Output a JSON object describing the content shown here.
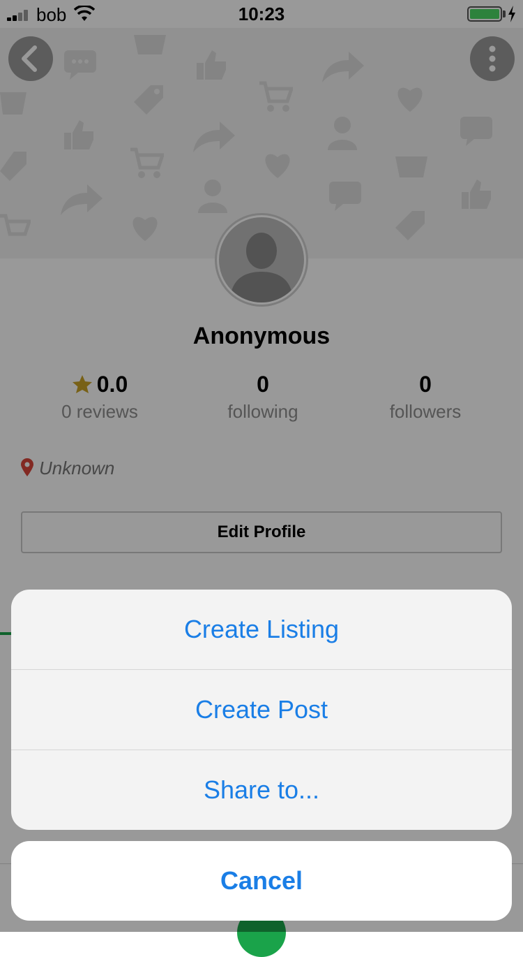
{
  "status_bar": {
    "carrier": "bob",
    "time": "10:23"
  },
  "profile": {
    "name": "Anonymous",
    "rating_value": "0.0",
    "reviews_label": "0 reviews",
    "following_count": "0",
    "following_label": "following",
    "followers_count": "0",
    "followers_label": "followers",
    "location": "Unknown",
    "edit_profile_label": "Edit Profile"
  },
  "action_sheet": {
    "items": [
      {
        "label": "Create Listing"
      },
      {
        "label": "Create Post"
      },
      {
        "label": "Share to..."
      }
    ],
    "cancel_label": "Cancel"
  },
  "colors": {
    "accent": "#1a7ee6",
    "brand_green": "#1aa34a",
    "star": "#c9a227",
    "pin": "#d9453a",
    "battery": "#4cd964"
  },
  "icons": [
    "back-chevron-icon",
    "more-vertical-icon",
    "star-icon",
    "location-pin-icon",
    "wifi-icon",
    "battery-icon",
    "charging-bolt-icon",
    "signal-icon"
  ]
}
